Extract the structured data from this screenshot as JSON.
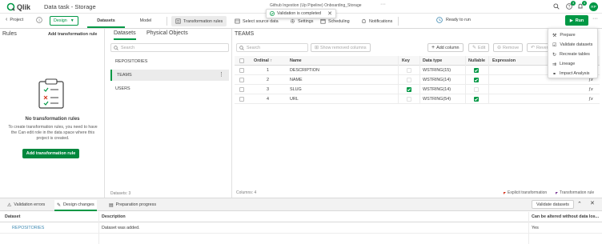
{
  "app": {
    "logo": "Qlik",
    "title": "Data task - Storage",
    "breadcrumb": "Github Ingestion (Up Pipeline) Onboarding_Storage",
    "notification_count": "4",
    "help_count": "3",
    "avatar_initials": "RP",
    "accent": "#009845"
  },
  "toast": {
    "text": "Validation is completed"
  },
  "toolbar": {
    "project_label": "Project",
    "design_label": "Design",
    "tabs": [
      "Datasets",
      "Model"
    ],
    "transformation_rules": "Transformation rules",
    "select_source_data": "Select source data",
    "settings": "Settings",
    "scheduling": "Scheduling",
    "notifications": "Notifications",
    "ready_to_run": "Ready to run",
    "run": "Run"
  },
  "rules_panel": {
    "title": "Rules",
    "add_link": "Add transformation rule",
    "empty_title": "No transformation rules",
    "empty_text": "To create transformation rules, you need to have the Can edit role in the data space where this project is created.",
    "add_button": "Add transformation rule"
  },
  "datasets_panel": {
    "tabs": [
      "Datasets",
      "Physical Objects"
    ],
    "search_placeholder": "Search",
    "items": [
      "REPOSITORIES",
      "TEAMS",
      "USERS"
    ],
    "count": "Datasets: 3"
  },
  "table_panel": {
    "title": "TEAMS",
    "search_placeholder": "Search",
    "show_removed": "Show removed columns",
    "add_column": "Add column",
    "edit": "Edit",
    "remove": "Remove",
    "revert": "Rever",
    "headers": [
      "Ordinal",
      "Name",
      "Key",
      "Data type",
      "Nullable",
      "Expression"
    ],
    "rows": [
      {
        "ordinal": "1",
        "name": "DESCRIPTION",
        "key": false,
        "type": "WSTRING(15)",
        "nullable": true
      },
      {
        "ordinal": "2",
        "name": "NAME",
        "key": false,
        "type": "WSTRING(14)",
        "nullable": true
      },
      {
        "ordinal": "3",
        "name": "SLUG",
        "key": true,
        "type": "WSTRING(14)",
        "nullable": false
      },
      {
        "ordinal": "4",
        "name": "URL",
        "key": false,
        "type": "WSTRING(54)",
        "nullable": true
      }
    ],
    "count": "Columns: 4",
    "legend_explicit": "Explicit transformation",
    "legend_rule": "Transformation rule"
  },
  "dropdown_menu": {
    "items": [
      {
        "label": "Prepare",
        "icon": "prepare-icon"
      },
      {
        "label": "Validate datasets",
        "icon": "validate-icon"
      },
      {
        "label": "Recreate tables",
        "icon": "recreate-icon"
      },
      {
        "label": "Lineage",
        "icon": "lineage-icon"
      },
      {
        "label": "Impact Analysis",
        "icon": "impact-icon"
      }
    ]
  },
  "bottom_panel": {
    "tabs": [
      "Validation errors",
      "Design changes",
      "Preparation progress"
    ],
    "validate_button": "Validate datasets",
    "headers": [
      "Dataset",
      "Description",
      "Can be altered without data los..."
    ],
    "rows": [
      {
        "dataset": "REPOSITORIES",
        "description": "Dataset was added.",
        "altered": "Yes"
      }
    ]
  }
}
